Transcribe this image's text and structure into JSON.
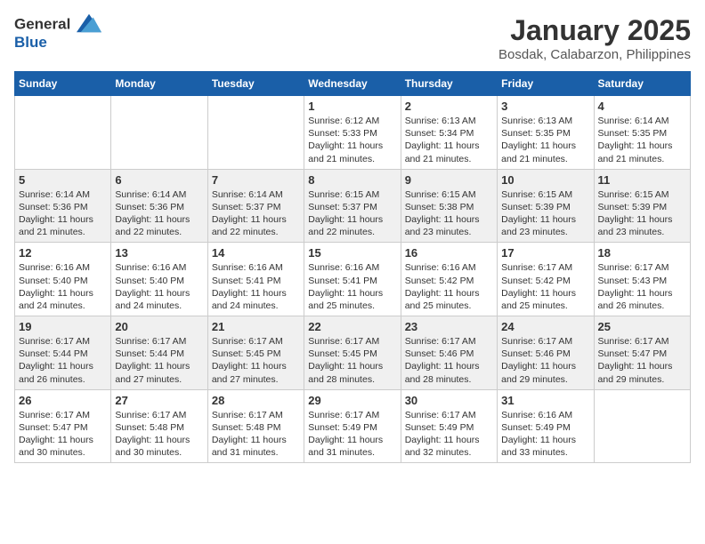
{
  "logo": {
    "line1": "General",
    "line2": "Blue"
  },
  "title": "January 2025",
  "subtitle": "Bosdak, Calabarzon, Philippines",
  "weekdays": [
    "Sunday",
    "Monday",
    "Tuesday",
    "Wednesday",
    "Thursday",
    "Friday",
    "Saturday"
  ],
  "weeks": [
    [
      {
        "date": "",
        "info": ""
      },
      {
        "date": "",
        "info": ""
      },
      {
        "date": "",
        "info": ""
      },
      {
        "date": "1",
        "info": "Sunrise: 6:12 AM\nSunset: 5:33 PM\nDaylight: 11 hours\nand 21 minutes."
      },
      {
        "date": "2",
        "info": "Sunrise: 6:13 AM\nSunset: 5:34 PM\nDaylight: 11 hours\nand 21 minutes."
      },
      {
        "date": "3",
        "info": "Sunrise: 6:13 AM\nSunset: 5:35 PM\nDaylight: 11 hours\nand 21 minutes."
      },
      {
        "date": "4",
        "info": "Sunrise: 6:14 AM\nSunset: 5:35 PM\nDaylight: 11 hours\nand 21 minutes."
      }
    ],
    [
      {
        "date": "5",
        "info": "Sunrise: 6:14 AM\nSunset: 5:36 PM\nDaylight: 11 hours\nand 21 minutes."
      },
      {
        "date": "6",
        "info": "Sunrise: 6:14 AM\nSunset: 5:36 PM\nDaylight: 11 hours\nand 22 minutes."
      },
      {
        "date": "7",
        "info": "Sunrise: 6:14 AM\nSunset: 5:37 PM\nDaylight: 11 hours\nand 22 minutes."
      },
      {
        "date": "8",
        "info": "Sunrise: 6:15 AM\nSunset: 5:37 PM\nDaylight: 11 hours\nand 22 minutes."
      },
      {
        "date": "9",
        "info": "Sunrise: 6:15 AM\nSunset: 5:38 PM\nDaylight: 11 hours\nand 23 minutes."
      },
      {
        "date": "10",
        "info": "Sunrise: 6:15 AM\nSunset: 5:39 PM\nDaylight: 11 hours\nand 23 minutes."
      },
      {
        "date": "11",
        "info": "Sunrise: 6:15 AM\nSunset: 5:39 PM\nDaylight: 11 hours\nand 23 minutes."
      }
    ],
    [
      {
        "date": "12",
        "info": "Sunrise: 6:16 AM\nSunset: 5:40 PM\nDaylight: 11 hours\nand 24 minutes."
      },
      {
        "date": "13",
        "info": "Sunrise: 6:16 AM\nSunset: 5:40 PM\nDaylight: 11 hours\nand 24 minutes."
      },
      {
        "date": "14",
        "info": "Sunrise: 6:16 AM\nSunset: 5:41 PM\nDaylight: 11 hours\nand 24 minutes."
      },
      {
        "date": "15",
        "info": "Sunrise: 6:16 AM\nSunset: 5:41 PM\nDaylight: 11 hours\nand 25 minutes."
      },
      {
        "date": "16",
        "info": "Sunrise: 6:16 AM\nSunset: 5:42 PM\nDaylight: 11 hours\nand 25 minutes."
      },
      {
        "date": "17",
        "info": "Sunrise: 6:17 AM\nSunset: 5:42 PM\nDaylight: 11 hours\nand 25 minutes."
      },
      {
        "date": "18",
        "info": "Sunrise: 6:17 AM\nSunset: 5:43 PM\nDaylight: 11 hours\nand 26 minutes."
      }
    ],
    [
      {
        "date": "19",
        "info": "Sunrise: 6:17 AM\nSunset: 5:44 PM\nDaylight: 11 hours\nand 26 minutes."
      },
      {
        "date": "20",
        "info": "Sunrise: 6:17 AM\nSunset: 5:44 PM\nDaylight: 11 hours\nand 27 minutes."
      },
      {
        "date": "21",
        "info": "Sunrise: 6:17 AM\nSunset: 5:45 PM\nDaylight: 11 hours\nand 27 minutes."
      },
      {
        "date": "22",
        "info": "Sunrise: 6:17 AM\nSunset: 5:45 PM\nDaylight: 11 hours\nand 28 minutes."
      },
      {
        "date": "23",
        "info": "Sunrise: 6:17 AM\nSunset: 5:46 PM\nDaylight: 11 hours\nand 28 minutes."
      },
      {
        "date": "24",
        "info": "Sunrise: 6:17 AM\nSunset: 5:46 PM\nDaylight: 11 hours\nand 29 minutes."
      },
      {
        "date": "25",
        "info": "Sunrise: 6:17 AM\nSunset: 5:47 PM\nDaylight: 11 hours\nand 29 minutes."
      }
    ],
    [
      {
        "date": "26",
        "info": "Sunrise: 6:17 AM\nSunset: 5:47 PM\nDaylight: 11 hours\nand 30 minutes."
      },
      {
        "date": "27",
        "info": "Sunrise: 6:17 AM\nSunset: 5:48 PM\nDaylight: 11 hours\nand 30 minutes."
      },
      {
        "date": "28",
        "info": "Sunrise: 6:17 AM\nSunset: 5:48 PM\nDaylight: 11 hours\nand 31 minutes."
      },
      {
        "date": "29",
        "info": "Sunrise: 6:17 AM\nSunset: 5:49 PM\nDaylight: 11 hours\nand 31 minutes."
      },
      {
        "date": "30",
        "info": "Sunrise: 6:17 AM\nSunset: 5:49 PM\nDaylight: 11 hours\nand 32 minutes."
      },
      {
        "date": "31",
        "info": "Sunrise: 6:16 AM\nSunset: 5:49 PM\nDaylight: 11 hours\nand 33 minutes."
      },
      {
        "date": "",
        "info": ""
      }
    ]
  ]
}
